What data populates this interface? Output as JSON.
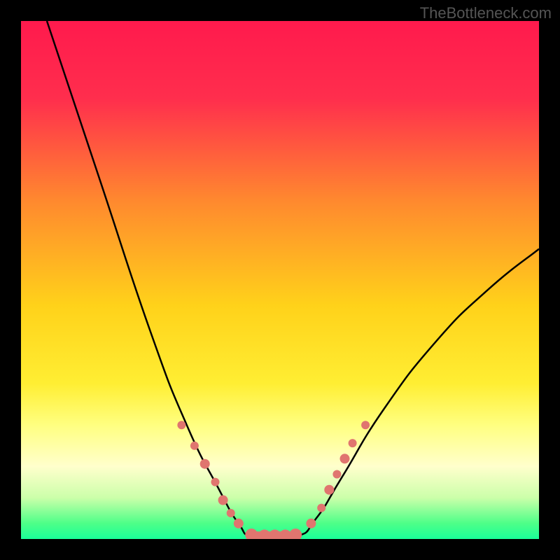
{
  "watermark": "TheBottleneck.com",
  "chart_data": {
    "type": "line",
    "title": "",
    "xlabel": "",
    "ylabel": "",
    "xlim": [
      0,
      100
    ],
    "ylim": [
      0,
      100
    ],
    "gradient_stops": [
      {
        "offset": 0,
        "color": "#ff1a4d"
      },
      {
        "offset": 15,
        "color": "#ff2e4d"
      },
      {
        "offset": 35,
        "color": "#ff8a2e"
      },
      {
        "offset": 55,
        "color": "#ffd21a"
      },
      {
        "offset": 70,
        "color": "#ffee33"
      },
      {
        "offset": 78,
        "color": "#ffff80"
      },
      {
        "offset": 86,
        "color": "#ffffcc"
      },
      {
        "offset": 92,
        "color": "#ccffaa"
      },
      {
        "offset": 97,
        "color": "#4dff88"
      },
      {
        "offset": 100,
        "color": "#1aff99"
      }
    ],
    "series": [
      {
        "name": "left-curve",
        "points": [
          {
            "x": 5,
            "y": 100
          },
          {
            "x": 15,
            "y": 70
          },
          {
            "x": 25,
            "y": 40
          },
          {
            "x": 32,
            "y": 22
          },
          {
            "x": 38,
            "y": 10
          },
          {
            "x": 42,
            "y": 3
          },
          {
            "x": 45,
            "y": 0.5
          }
        ]
      },
      {
        "name": "right-curve",
        "points": [
          {
            "x": 53,
            "y": 0.5
          },
          {
            "x": 57,
            "y": 4
          },
          {
            "x": 62,
            "y": 12
          },
          {
            "x": 70,
            "y": 25
          },
          {
            "x": 80,
            "y": 38
          },
          {
            "x": 90,
            "y": 48
          },
          {
            "x": 100,
            "y": 56
          }
        ]
      },
      {
        "name": "bottom-flat",
        "points": [
          {
            "x": 45,
            "y": 0.5
          },
          {
            "x": 53,
            "y": 0.5
          }
        ]
      }
    ],
    "markers": {
      "color": "#e0756f",
      "radius_small": 6,
      "radius_large": 10,
      "points": [
        {
          "x": 31,
          "y": 22,
          "r": 6
        },
        {
          "x": 33.5,
          "y": 18,
          "r": 6
        },
        {
          "x": 35.5,
          "y": 14.5,
          "r": 7
        },
        {
          "x": 37.5,
          "y": 11,
          "r": 6
        },
        {
          "x": 39,
          "y": 7.5,
          "r": 7
        },
        {
          "x": 40.5,
          "y": 5,
          "r": 6
        },
        {
          "x": 42,
          "y": 3,
          "r": 7
        },
        {
          "x": 44.5,
          "y": 0.8,
          "r": 9
        },
        {
          "x": 47,
          "y": 0.6,
          "r": 9
        },
        {
          "x": 49,
          "y": 0.6,
          "r": 9
        },
        {
          "x": 51,
          "y": 0.6,
          "r": 9
        },
        {
          "x": 53,
          "y": 0.8,
          "r": 9
        },
        {
          "x": 56,
          "y": 3,
          "r": 7
        },
        {
          "x": 58,
          "y": 6,
          "r": 6
        },
        {
          "x": 59.5,
          "y": 9.5,
          "r": 7
        },
        {
          "x": 61,
          "y": 12.5,
          "r": 6
        },
        {
          "x": 62.5,
          "y": 15.5,
          "r": 7
        },
        {
          "x": 64,
          "y": 18.5,
          "r": 6
        },
        {
          "x": 66.5,
          "y": 22,
          "r": 6
        }
      ]
    }
  }
}
